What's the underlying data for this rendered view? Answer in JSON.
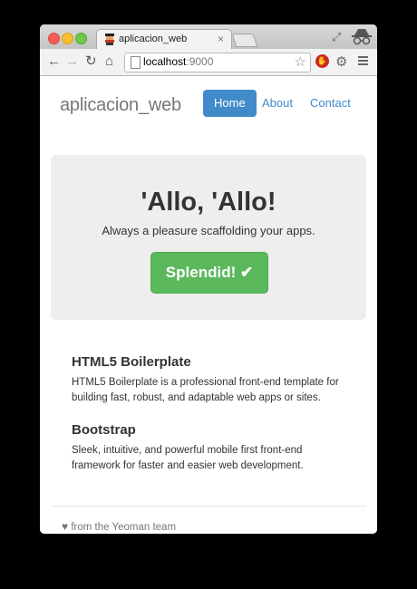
{
  "browser": {
    "tab_title": "aplicacion_web",
    "url_host": "localhost",
    "url_port": ":9000",
    "icons": [
      "back-icon",
      "forward-icon",
      "reload-icon",
      "home-icon",
      "star-icon",
      "menu-icon"
    ]
  },
  "navbar": {
    "brand": "aplicacion_web",
    "items": [
      {
        "label": "Home",
        "active": true
      },
      {
        "label": "About",
        "active": false
      },
      {
        "label": "Contact",
        "active": false
      }
    ]
  },
  "jumbotron": {
    "title": "'Allo, 'Allo!",
    "lead": "Always a pleasure scaffolding your apps.",
    "button_label": "Splendid! ✔",
    "button_color": "#5cb85c"
  },
  "sections": [
    {
      "title": "HTML5 Boilerplate",
      "text": "HTML5 Boilerplate is a professional front-end template for building fast, robust, and adaptable web apps or sites."
    },
    {
      "title": "Bootstrap",
      "text": "Sleek, intuitive, and powerful mobile first front-end framework for faster and easier web development."
    }
  ],
  "footer": {
    "heart": "♥",
    "text": " from the Yeoman team"
  },
  "colors": {
    "accent": "#428bca",
    "jumbotron_bg": "#eeeeee"
  }
}
